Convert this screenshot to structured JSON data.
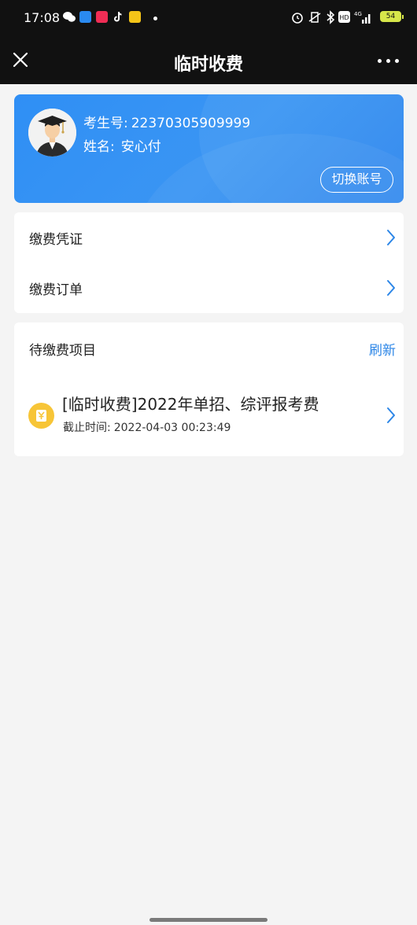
{
  "status_bar": {
    "time": "17:08",
    "battery": "54",
    "network": "4G"
  },
  "nav": {
    "title": "临时收费",
    "close_icon": "close-icon",
    "more_icon": "more-icon"
  },
  "profile": {
    "exam_id_label": "考生号:",
    "exam_id": "22370305909999",
    "name_label": "姓名:",
    "name": "安心付",
    "switch_button": "切换账号"
  },
  "menu": {
    "items": [
      {
        "label": "缴费凭证"
      },
      {
        "label": "缴费订单"
      }
    ]
  },
  "pending": {
    "title": "待缴费项目",
    "refresh": "刷新",
    "items": [
      {
        "name": "[临时收费]2022年单招、综评报考费",
        "deadline_label": "截止时间:",
        "deadline": "2022-04-03 00:23:49"
      }
    ]
  },
  "colors": {
    "card_blue": "#3a95f3",
    "accent_blue": "#2c86e7",
    "fee_icon_yellow": "#f7c537",
    "header_dark": "#111111"
  }
}
